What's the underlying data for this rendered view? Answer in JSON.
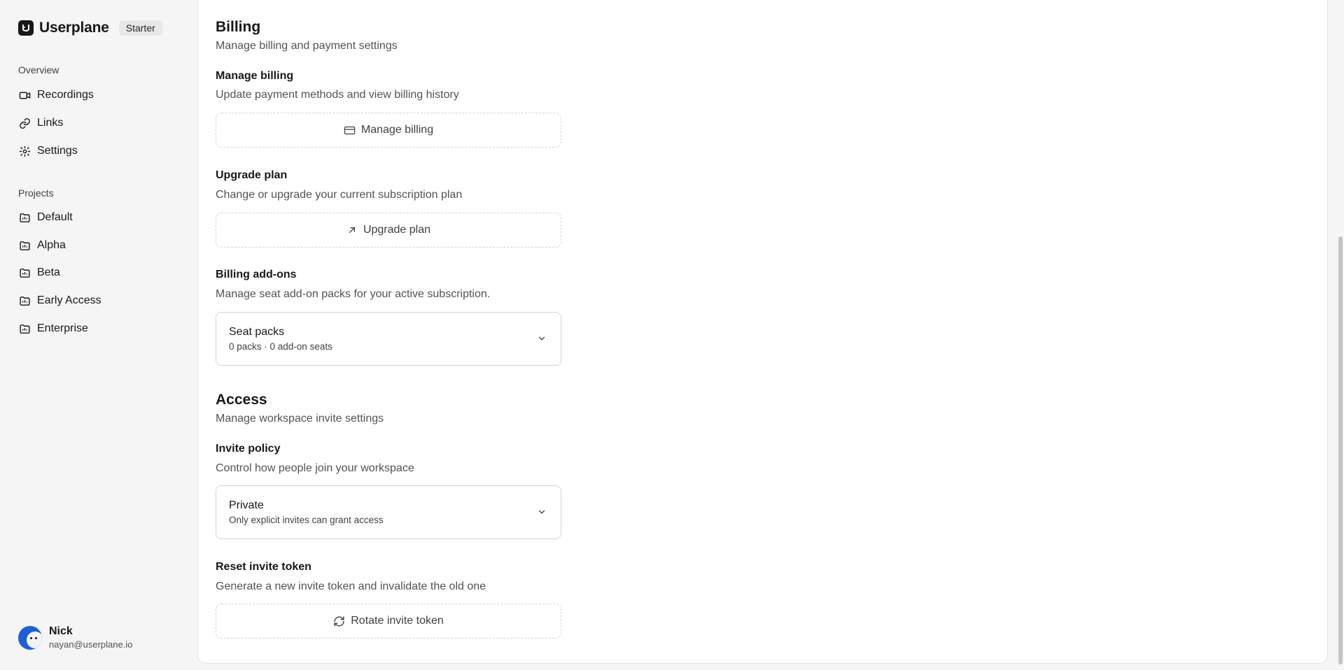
{
  "sidebar": {
    "brand_name": "Userplane",
    "plan_badge": "Starter",
    "overview_label": "Overview",
    "overview_items": [
      {
        "label": "Recordings",
        "icon": "video-icon"
      },
      {
        "label": "Links",
        "icon": "link-icon"
      },
      {
        "label": "Settings",
        "icon": "gear-icon"
      }
    ],
    "projects_label": "Projects",
    "project_items": [
      {
        "label": "Default",
        "icon": "folder-icon"
      },
      {
        "label": "Alpha",
        "icon": "folder-icon"
      },
      {
        "label": "Beta",
        "icon": "folder-icon"
      },
      {
        "label": "Early Access",
        "icon": "folder-icon"
      },
      {
        "label": "Enterprise",
        "icon": "folder-icon"
      }
    ],
    "user": {
      "name": "Nick",
      "email": "nayan@userplane.io"
    }
  },
  "billing": {
    "title": "Billing",
    "subtitle": "Manage billing and payment settings",
    "manage": {
      "heading": "Manage billing",
      "description": "Update payment methods and view billing history",
      "button_label": "Manage billing"
    },
    "upgrade": {
      "heading": "Upgrade plan",
      "description": "Change or upgrade your current subscription plan",
      "button_label": "Upgrade plan"
    },
    "addons": {
      "heading": "Billing add-ons",
      "description": "Manage seat add-on packs for your active subscription.",
      "select_title": "Seat packs",
      "select_desc": "0 packs · 0 add-on seats"
    }
  },
  "access": {
    "title": "Access",
    "subtitle": "Manage workspace invite settings",
    "invite_policy": {
      "heading": "Invite policy",
      "description": "Control how people join your workspace",
      "select_title": "Private",
      "select_desc": "Only explicit invites can grant access"
    },
    "reset_token": {
      "heading": "Reset invite token",
      "description": "Generate a new invite token and invalidate the old one",
      "button_label": "Rotate invite token"
    }
  },
  "colors": {
    "page_bg": "#f5f5f5",
    "panel_bg": "#ffffff",
    "text_primary": "#18181b",
    "text_muted": "#52525b",
    "avatar_bg": "#1e5fd6"
  }
}
